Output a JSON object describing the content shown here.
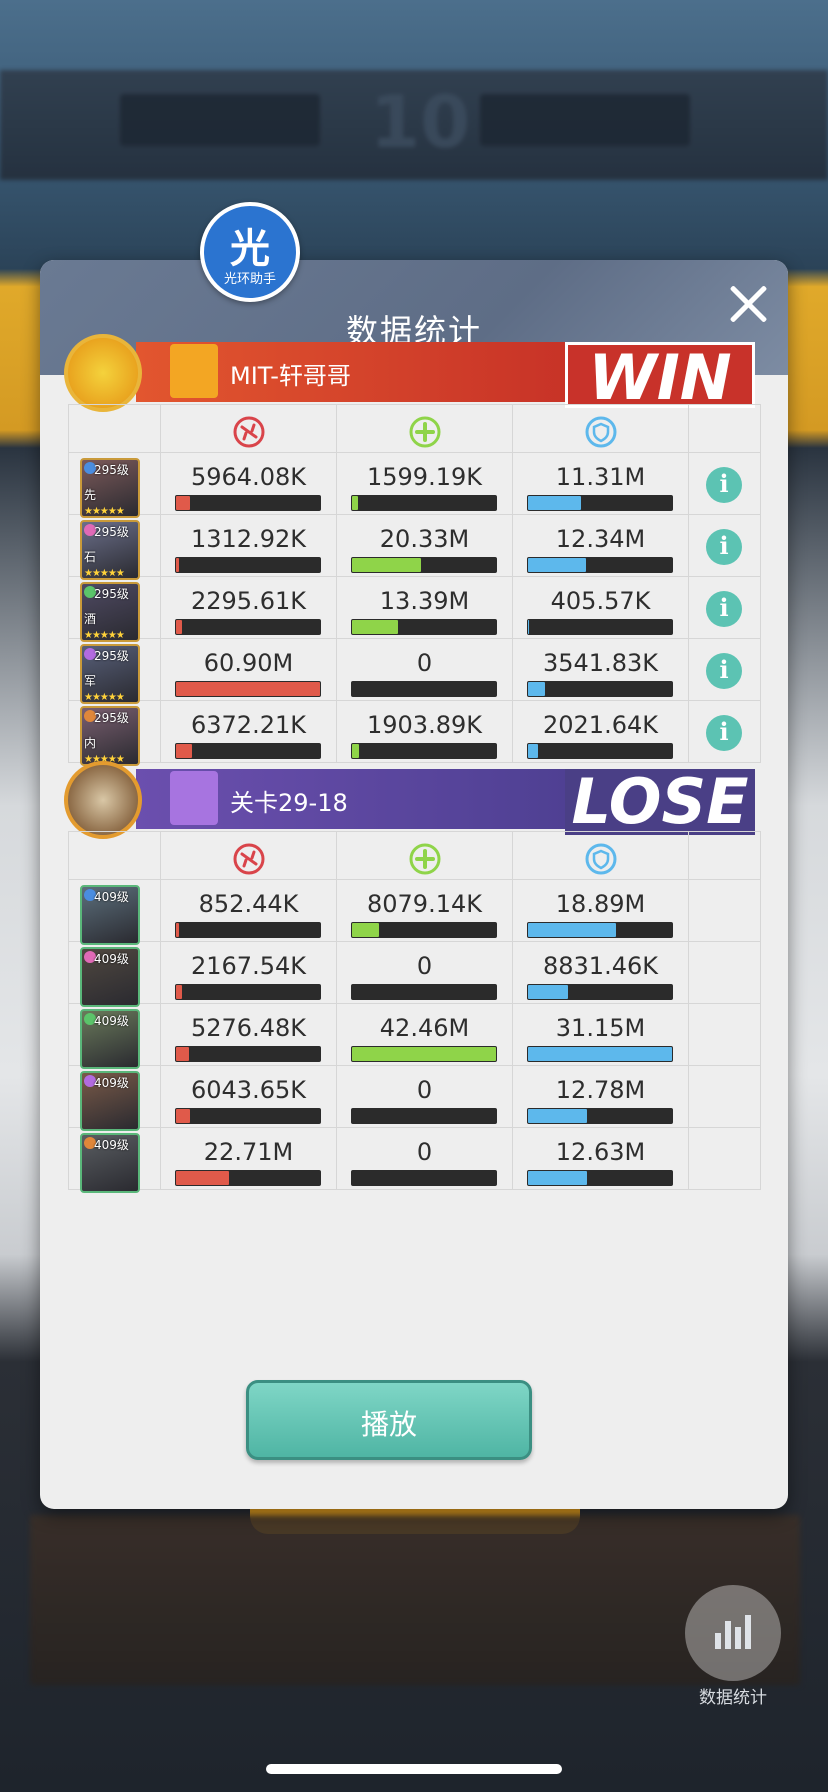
{
  "dialog": {
    "title": "数据统计",
    "badge_char": "光",
    "badge_sub": "光环助手",
    "play_label": "播放"
  },
  "column_icons": [
    "damage-icon",
    "heal-icon",
    "shield-icon"
  ],
  "colors": {
    "damage": "#e05a4a",
    "heal": "#8fd449",
    "shield": "#5db8ec",
    "win": "#c8322a",
    "lose": "#4a3f86"
  },
  "teams": [
    {
      "name": "MIT-轩哥哥",
      "result": "WIN",
      "heroes": [
        {
          "level": "295级",
          "class": "先",
          "values": [
            "5964.08K",
            "1599.19K",
            "11.31M"
          ],
          "fills": [
            0.1,
            0.04,
            0.37
          ],
          "info": "i"
        },
        {
          "level": "295级",
          "class": "石",
          "values": [
            "1312.92K",
            "20.33M",
            "12.34M"
          ],
          "fills": [
            0.02,
            0.48,
            0.4
          ],
          "info": "i"
        },
        {
          "level": "295级",
          "class": "酒",
          "values": [
            "2295.61K",
            "13.39M",
            "405.57K"
          ],
          "fills": [
            0.04,
            0.32,
            0.01
          ],
          "info": "i"
        },
        {
          "level": "295级",
          "class": "军",
          "values": [
            "60.90M",
            "0",
            "3541.83K"
          ],
          "fills": [
            1.0,
            0.0,
            0.12
          ],
          "info": "i"
        },
        {
          "level": "295级",
          "class": "内",
          "values": [
            "6372.21K",
            "1903.89K",
            "2021.64K"
          ],
          "fills": [
            0.11,
            0.05,
            0.07
          ],
          "info": "i"
        }
      ]
    },
    {
      "name": "关卡29-18",
      "result": "LOSE",
      "heroes": [
        {
          "level": "409级",
          "values": [
            "852.44K",
            "8079.14K",
            "18.89M"
          ],
          "fills": [
            0.02,
            0.19,
            0.61
          ]
        },
        {
          "level": "409级",
          "values": [
            "2167.54K",
            "0",
            "8831.46K"
          ],
          "fills": [
            0.04,
            0.0,
            0.28
          ]
        },
        {
          "level": "409级",
          "values": [
            "5276.48K",
            "42.46M",
            "31.15M"
          ],
          "fills": [
            0.09,
            1.0,
            1.0
          ]
        },
        {
          "level": "409级",
          "values": [
            "6043.65K",
            "0",
            "12.78M"
          ],
          "fills": [
            0.1,
            0.0,
            0.41
          ]
        },
        {
          "level": "409级",
          "values": [
            "22.71M",
            "0",
            "12.63M"
          ],
          "fills": [
            0.37,
            0.0,
            0.41
          ]
        }
      ]
    }
  ],
  "background": {
    "score": "10",
    "stat_button_label": "数据统计"
  }
}
